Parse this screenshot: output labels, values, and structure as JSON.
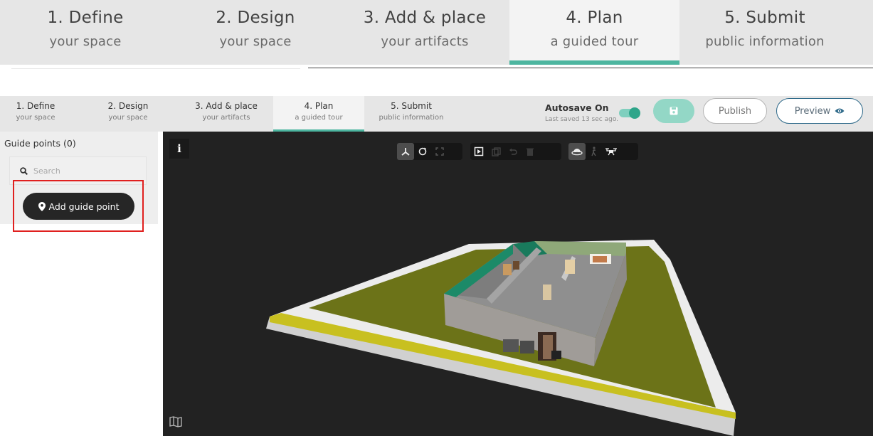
{
  "big_steps": [
    {
      "title": "1. Define",
      "subtitle": "your space",
      "active": false
    },
    {
      "title": "2. Design",
      "subtitle": "your space",
      "active": false
    },
    {
      "title": "3. Add & place",
      "subtitle": "your artifacts",
      "active": false
    },
    {
      "title": "4. Plan",
      "subtitle": "a guided tour",
      "active": true
    },
    {
      "title": "5. Submit",
      "subtitle": "public information",
      "active": false
    }
  ],
  "small_steps": [
    {
      "title": "1. Define",
      "subtitle": "your space",
      "active": false
    },
    {
      "title": "2. Design",
      "subtitle": "your space",
      "active": false
    },
    {
      "title": "3. Add & place",
      "subtitle": "your artifacts",
      "active": false
    },
    {
      "title": "4. Plan",
      "subtitle": "a guided tour",
      "active": true
    },
    {
      "title": "5. Submit",
      "subtitle": "public information",
      "active": false
    }
  ],
  "autosave": {
    "label": "Autosave On",
    "last_saved": "Last saved 13 sec ago.",
    "enabled": true
  },
  "actions": {
    "publish_label": "Publish",
    "preview_label": "Preview",
    "save_icon": "floppy-disk-icon",
    "preview_icon": "eye-icon"
  },
  "sidebar": {
    "title": "Guide points (0)",
    "search_placeholder": "Search",
    "search_value": "",
    "add_button_label": "Add guide point",
    "add_button_icon": "map-marker-icon"
  },
  "viewport": {
    "info_icon": "info-icon",
    "toolbar_groups": [
      [
        "axes-icon",
        "rotate-icon",
        "fullscreen-icon"
      ],
      [
        "play-tour-icon",
        "copy-icon",
        "undo-icon",
        "trash-icon"
      ],
      [
        "orbit-view-icon",
        "walk-icon",
        "drone-icon"
      ]
    ],
    "minimap_icon": "map-icon"
  },
  "colors": {
    "accent": "#4db6a0",
    "save_disabled": "#93d7c6",
    "preview_border": "#2f6a8a",
    "dark_button": "#262626",
    "highlight": "#e0201f",
    "viewport_bg": "#222222"
  }
}
